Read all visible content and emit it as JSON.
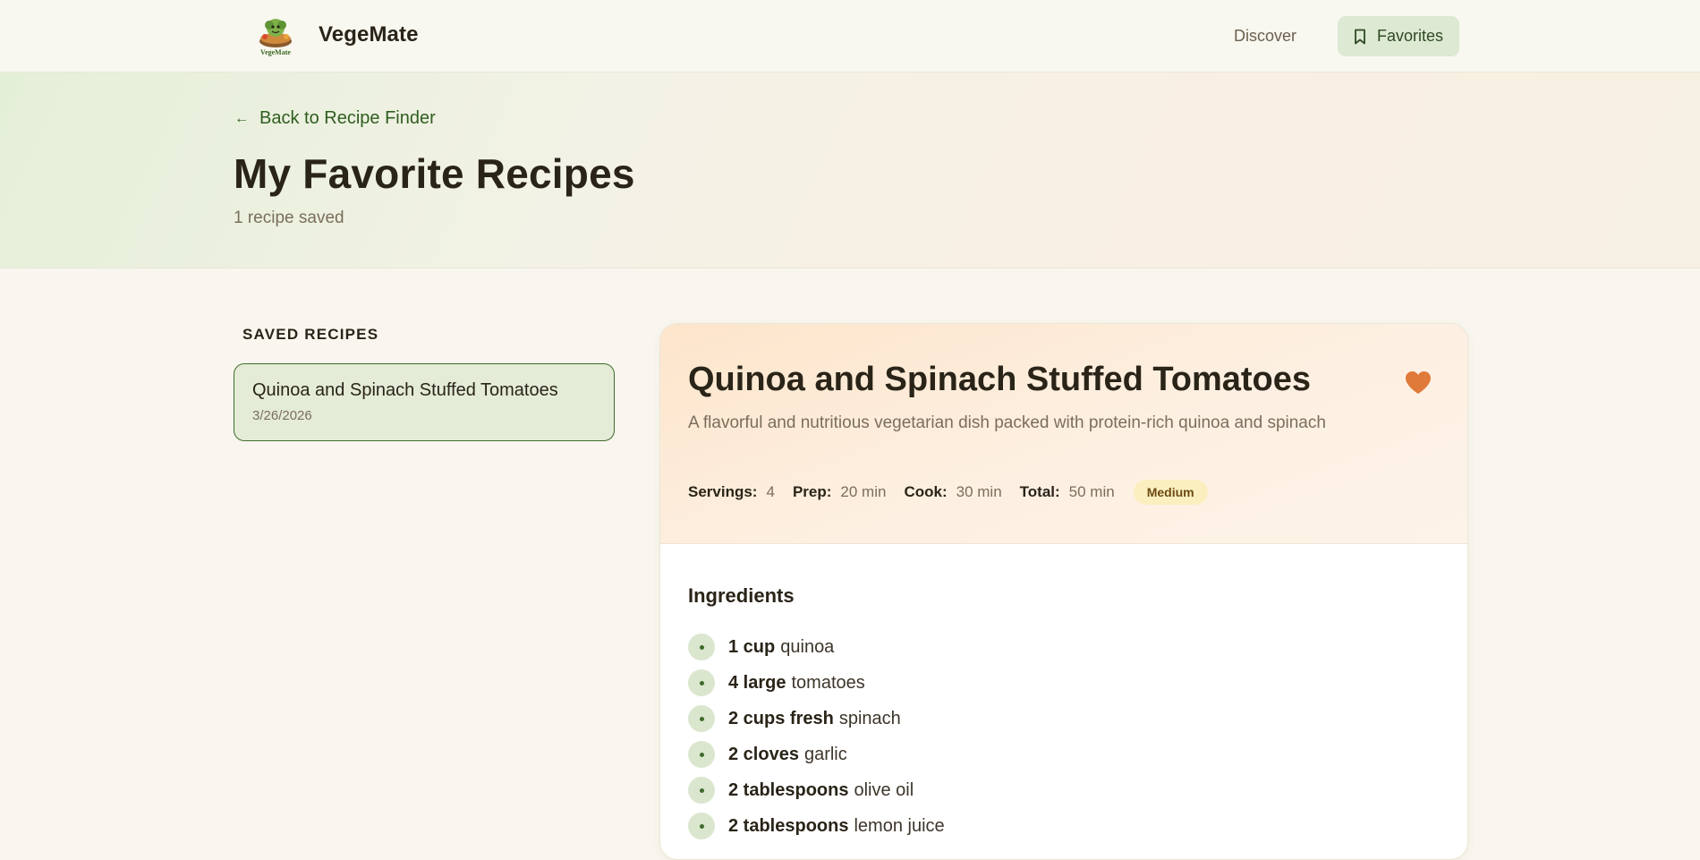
{
  "brand": {
    "name": "VegeMate",
    "logo_text": "VegeMate"
  },
  "nav": {
    "discover": "Discover",
    "favorites": "Favorites"
  },
  "header": {
    "back_label": "Back to Recipe Finder",
    "title": "My Favorite Recipes",
    "count": "1 recipe saved"
  },
  "sidebar": {
    "heading": "SAVED RECIPES",
    "items": [
      {
        "title": "Quinoa and Spinach Stuffed Tomatoes",
        "date": "3/26/2026"
      }
    ]
  },
  "recipe": {
    "title": "Quinoa and Spinach Stuffed Tomatoes",
    "description": "A flavorful and nutritious vegetarian dish packed with protein-rich quinoa and spinach",
    "favorited": true,
    "meta": {
      "servings_label": "Servings:",
      "servings": "4",
      "prep_label": "Prep:",
      "prep": "20 min",
      "cook_label": "Cook:",
      "cook": "30 min",
      "total_label": "Total:",
      "total": "50 min",
      "difficulty": "Medium"
    },
    "ingredients_heading": "Ingredients",
    "ingredients": [
      {
        "qty": "1 cup",
        "name": "quinoa"
      },
      {
        "qty": "4 large",
        "name": "tomatoes"
      },
      {
        "qty": "2 cups fresh",
        "name": "spinach"
      },
      {
        "qty": "2 cloves",
        "name": "garlic"
      },
      {
        "qty": "2 tablespoons",
        "name": "olive oil"
      },
      {
        "qty": "2 tablespoons",
        "name": "lemon juice"
      }
    ]
  },
  "colors": {
    "accent_green": "#2f5d1f",
    "heart": "#e07a3a",
    "background": "#f8f6ee"
  },
  "icons": {
    "back": "arrow-left-icon",
    "favorites": "bookmark-icon",
    "heart": "heart-icon",
    "bullet": "dot-icon"
  }
}
